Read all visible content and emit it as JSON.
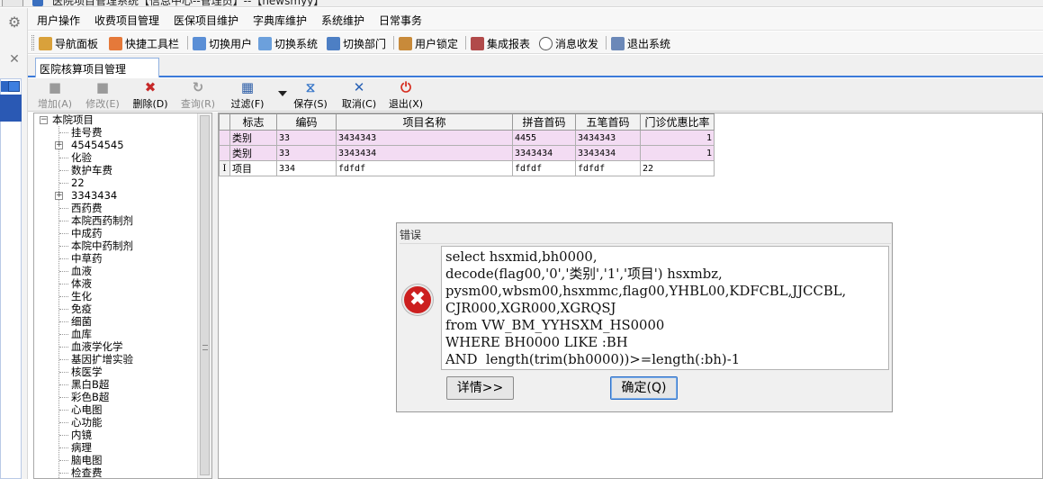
{
  "window": {
    "title": "医院项目管理系统【信息中心--管理员】--【newsmyy】"
  },
  "menu": [
    "用户操作",
    "收费项目管理",
    "医保项目维护",
    "字典库维护",
    "系统维护",
    "日常事务"
  ],
  "toolbar": {
    "items": [
      "导航面板",
      "快捷工具栏",
      "切换用户",
      "切换系统",
      "切换部门",
      "用户锁定",
      "集成报表",
      "消息收发",
      "退出系统"
    ]
  },
  "tab": {
    "label": "医院核算项目管理"
  },
  "actions": {
    "add": "增加(A)",
    "edit": "修改(E)",
    "delete": "删除(D)",
    "query": "查询(R)",
    "filter": "过滤(F)",
    "save": "保存(S)",
    "cancel": "取消(C)",
    "exit": "退出(X)"
  },
  "tree": {
    "root": "本院项目",
    "items": [
      "挂号费",
      "45454545",
      "化验",
      "数护车费",
      "22",
      "3343434",
      "西药费",
      "本院西药制剂",
      "中成药",
      "本院中药制剂",
      "中草药",
      "血液",
      "体液",
      "生化",
      "免疫",
      "细菌",
      "血库",
      "血液学化学",
      "基因扩增实验",
      "核医学",
      "黑白B超",
      "彩色B超",
      "心电图",
      "心功能",
      "内镜",
      "病理",
      "脑电图",
      "检查费"
    ]
  },
  "grid": {
    "columns": [
      "标志",
      "编码",
      "项目名称",
      "拼音首码",
      "五笔首码",
      "门诊优惠比率"
    ],
    "rows": [
      [
        "类别",
        "33",
        "3434343",
        "4455",
        "3434343",
        "1"
      ],
      [
        "类别",
        "33",
        "3343434",
        "3343434",
        "3343434",
        "1"
      ],
      [
        "项目",
        "334",
        "fdfdf",
        "fdfdf",
        "fdfdf",
        "22"
      ]
    ]
  },
  "dialog": {
    "title": "错误",
    "message": "select hsxmid,bh0000,\ndecode(flag00,'0','类别','1','项目') hsxmbz,\npysm00,wbsm00,hsxmmc,flag00,YHBL00,KDFCBL,JJCCBL,\nCJR000,XGR000,XGRQSJ\nfrom VW_BM_YYHSXM_HS0000\nWHERE BH0000 LIKE :BH\nAND  length(trim(bh0000))>=length(:bh)-1",
    "details_button": "详情>>",
    "ok_button": "确定(Q)"
  },
  "colors": {
    "accent": "#3b7ad9",
    "category_row": "#f3dcf3",
    "error": "#cc1f1f"
  },
  "icons": [
    "settings-icon",
    "close-icon",
    "navigation-panel-icon",
    "quick-toolbar-icon",
    "switch-user-icon",
    "switch-system-icon",
    "switch-department-icon",
    "user-lock-icon",
    "integrated-report-icon",
    "message-icon",
    "exit-system-icon",
    "error-icon"
  ]
}
